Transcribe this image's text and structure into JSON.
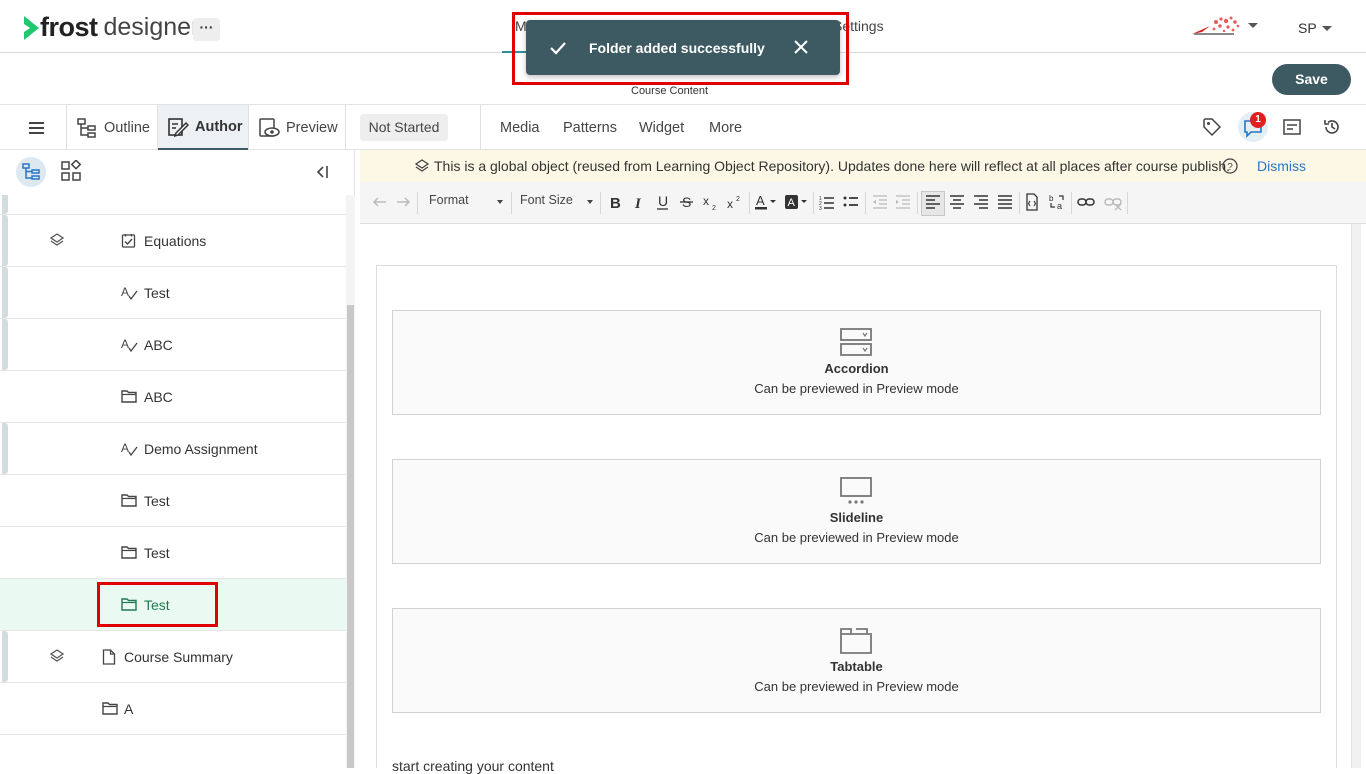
{
  "app": {
    "logo_word1": "frost",
    "logo_word2": "designer",
    "more_menu": "···",
    "top_tabs": [
      {
        "label": "My"
      },
      {
        "label": "Settings"
      }
    ],
    "user_initials": "SP"
  },
  "toast": {
    "message": "Folder added successfully"
  },
  "header": {
    "course_content_label": "Course Content",
    "save_label": "Save"
  },
  "toolbar": {
    "outline_label": "Outline",
    "author_label": "Author",
    "preview_label": "Preview",
    "status": "Not Started",
    "menus": [
      "Media",
      "Patterns",
      "Widget",
      "More"
    ],
    "comment_count": "1"
  },
  "tree": {
    "items": [
      {
        "label": "Equations",
        "icon": "quiz-icon",
        "has_layers": true
      },
      {
        "label": "Test",
        "icon": "assessment-icon",
        "has_layers": false
      },
      {
        "label": "ABC",
        "icon": "assessment-icon",
        "has_layers": false
      },
      {
        "label": "ABC",
        "icon": "folder-icon",
        "has_layers": false
      },
      {
        "label": "Demo Assignment",
        "icon": "assessment-icon",
        "has_layers": false
      },
      {
        "label": "Test",
        "icon": "folder-icon",
        "has_layers": false
      },
      {
        "label": "Test",
        "icon": "folder-icon",
        "has_layers": false
      },
      {
        "label": "Test",
        "icon": "folder-icon",
        "has_layers": false,
        "selected": true
      },
      {
        "label": "Course Summary",
        "icon": "page-icon",
        "has_layers": true
      },
      {
        "label": "A",
        "icon": "folder-icon",
        "has_layers": false
      }
    ]
  },
  "banner": {
    "text": "This is a global object (reused from Learning Object Repository). Updates done here will reflect at all places after course publish.",
    "dismiss_label": "Dismiss"
  },
  "editor_toolbar": {
    "format_label": "Format",
    "font_size_label": "Font Size"
  },
  "editor": {
    "widgets": [
      {
        "name": "Accordion",
        "description": "Can be previewed in Preview mode",
        "icon": "accordion-icon"
      },
      {
        "name": "Slideline",
        "description": "Can be previewed in Preview mode",
        "icon": "slideline-icon"
      },
      {
        "name": "Tabtable",
        "description": "Can be previewed in Preview mode",
        "icon": "tabtable-icon"
      }
    ],
    "footer_text": "start creating your content"
  },
  "colors": {
    "primary": "#3d5a62",
    "accent_teal": "#2f8f9d",
    "selected_bg": "#eafaf3",
    "selected_text": "#1f7a52",
    "link": "#2577c9",
    "badge": "#e02020",
    "highlight": "#e00000",
    "banner_bg": "#fdf8e6"
  }
}
